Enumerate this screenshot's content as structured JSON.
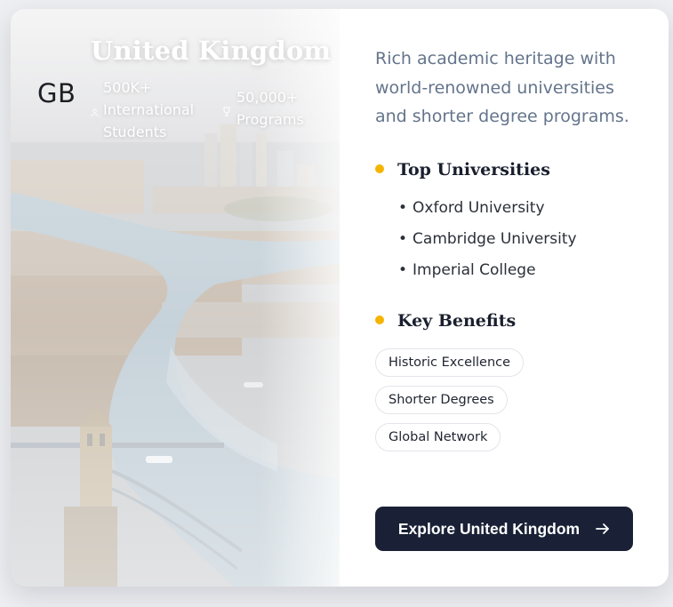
{
  "country": {
    "name": "United Kingdom",
    "code": "GB",
    "stats": [
      {
        "value": "500K+",
        "label": "International Students",
        "icon": "user-icon"
      },
      {
        "value": "50,000+",
        "label": "Programs",
        "icon": "trophy-icon"
      }
    ],
    "image_alt": "aerial view of London with Tower Bridge and the River Thames"
  },
  "description": "Rich academic heritage with world-renowned universities and shorter degree programs.",
  "top_universities": {
    "title": "Top Universities",
    "items": [
      "Oxford University",
      "Cambridge University",
      "Imperial College"
    ]
  },
  "key_benefits": {
    "title": "Key Benefits",
    "tags": [
      "Historic Excellence",
      "Shorter Degrees",
      "Global Network"
    ]
  },
  "cta": {
    "label": "Explore United Kingdom",
    "icon": "arrow-right-icon"
  },
  "colors": {
    "accent_dot": "#f5b400",
    "button_bg": "#1a2136",
    "text_muted": "#64748b",
    "heading": "#1a1f2e"
  }
}
